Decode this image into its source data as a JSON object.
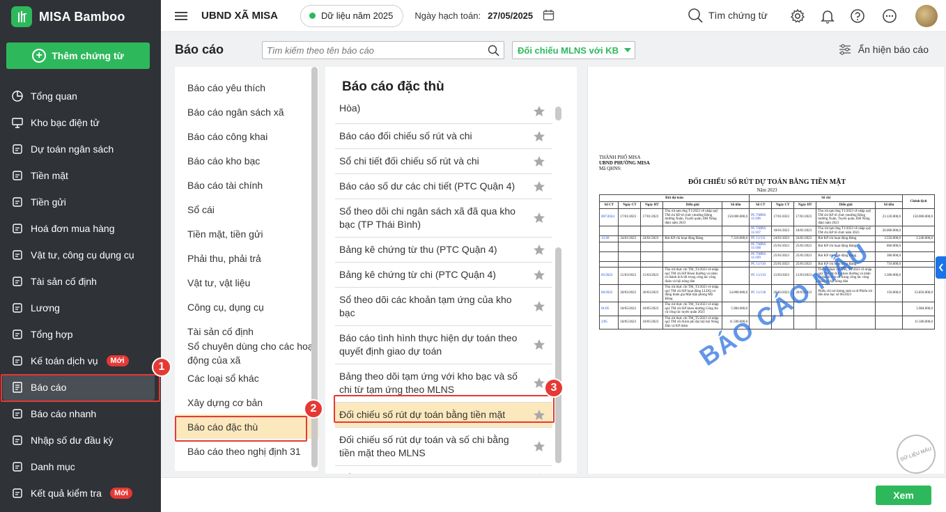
{
  "brand": {
    "name": "MISA Bamboo"
  },
  "sidebar": {
    "add_button": "Thêm chứng từ",
    "new_badge": "Mới",
    "items": [
      {
        "label": "Tổng quan",
        "icon": "pie-chart-icon"
      },
      {
        "label": "Kho bạc điện tử",
        "icon": "monitor-icon"
      },
      {
        "label": "Dự toán ngân sách",
        "icon": "budget-icon"
      },
      {
        "label": "Tiền mặt",
        "icon": "cash-icon"
      },
      {
        "label": "Tiền gửi",
        "icon": "deposit-icon"
      },
      {
        "label": "Hoá đơn mua hàng",
        "icon": "invoice-icon"
      },
      {
        "label": "Vật tư, công cụ dụng cụ",
        "icon": "tools-icon"
      },
      {
        "label": "Tài sản cố định",
        "icon": "building-icon"
      },
      {
        "label": "Lương",
        "icon": "salary-icon"
      },
      {
        "label": "Tổng hợp",
        "icon": "summary-icon"
      },
      {
        "label": "Kế toán dịch vụ",
        "icon": "service-icon",
        "badge": "Mới"
      },
      {
        "label": "Báo cáo",
        "icon": "report-icon",
        "active": true
      },
      {
        "label": "Báo cáo nhanh",
        "icon": "quick-report-icon"
      },
      {
        "label": "Nhập số dư đầu kỳ",
        "icon": "opening-balance-icon"
      },
      {
        "label": "Danh mục",
        "icon": "catalog-icon"
      },
      {
        "label": "Kết quả kiểm tra",
        "icon": "check-result-icon",
        "badge": "Mới"
      }
    ]
  },
  "header": {
    "org": "UBND XÃ MISA",
    "data_year": "Dữ liệu năm 2025",
    "posting_date_label": "Ngày hạch toán:",
    "posting_date": "27/05/2025",
    "search_label": "Tìm chứng từ"
  },
  "toolbar": {
    "title": "Báo cáo",
    "search_placeholder": "Tìm kiếm theo tên báo cáo",
    "filter_value": "Đối chiếu MLNS với KB",
    "toggle_label": "Ẩn hiện báo cáo"
  },
  "categories": [
    "Báo cáo yêu thích",
    "Báo cáo ngân sách xã",
    "Báo cáo công khai",
    "Báo cáo kho bạc",
    "Báo cáo tài chính",
    "Sổ cái",
    "Tiền mặt, tiền gửi",
    "Phải thu, phải trả",
    "Vật tư, vật liệu",
    "Công cụ, dụng cụ",
    "Tài sản cố định",
    "Sổ chuyên dùng cho các hoạt động của xã",
    "Các loại sổ khác",
    "Xây dựng cơ bản",
    "Báo cáo đặc thù",
    "Báo cáo theo nghị định 31"
  ],
  "report_list": {
    "title": "Báo cáo đặc thù",
    "items": [
      "Hòa)",
      "Báo cáo đối chiếu số rút và chi",
      "Sổ chi tiết đối chiếu số rút và chi",
      "Báo cáo số dư các chi tiết (PTC Quận 4)",
      "Sổ theo dõi chi ngân sách xã đã qua kho bạc (TP Thái Bình)",
      "Bảng kê chứng từ thu (PTC Quận 4)",
      "Bảng kê chứng từ chi (PTC Quận 4)",
      "Sổ theo dõi các khoản tạm ứng của kho bạc",
      "Báo cáo tình hình thực hiện dự toán theo quyết định giao dự toán",
      "Bảng theo dõi tạm ứng với kho bạc và số chi từ tạm ứng theo MLNS",
      "Đối chiếu số rút dự toán bằng tiền mặt",
      "Đối chiếu số rút dự toán và số chi bằng tiền mặt theo MLNS",
      "Sổ theo dõi các khoản rút dự toán"
    ]
  },
  "steps": [
    "1",
    "2",
    "3"
  ],
  "preview": {
    "header_lines": [
      "THÀNH PHỐ MISA",
      "UBND PHƯỜNG MISA",
      "Mã QHNS:"
    ],
    "title": "ĐỐI CHIẾU SỐ RÚT DỰ TOÁN BẰNG TIỀN MẶT",
    "year": "Năm 2023",
    "group_withdraw": "Rút dự toán",
    "group_spend": "Số chi",
    "diff_header": "Chênh lệch",
    "columns_withdraw": [
      "Số CT",
      "Ngày CT",
      "Ngày HT",
      "Diễn giải",
      "Số tiền"
    ],
    "columns_spend": [
      "Số CT",
      "Ngày CT",
      "Ngày HT",
      "Diễn giải",
      "Số tiền"
    ],
    "rows": [
      [
        "007/2024",
        "17/01/2023",
        "17/01/2023",
        "Thu rút tạm ứng T1/2023 về nhập quỹ TM chi KP tổ chức (mường Đông mường Xuân, Tuyên quân, ĐH Nông dân) năm 2023",
        "150.000.000,0",
        "PC TMNS 11/106",
        "17/01/2023",
        "17/01/2023",
        "Thu rút tạm ứng T1/2023 về nhập quỹ TM chi KP tổ chức (mường Đông mường Xuân, Tuyên quân, ĐH Nông dân) năm 2023",
        "23.120.000,0",
        "150.000.000,0"
      ],
      [
        "",
        "",
        "",
        "",
        "",
        "PC TMNS 11/107",
        "18/01/2023",
        "18/01/2023",
        "Thu rút tạm ứng T1/2023 về nhập quỹ TM chi KP tổ chức năm 2023",
        "26.000.000,0",
        ""
      ],
      [
        "12/49",
        "24/01/2023",
        "24/01/2023",
        "Rút KP chi hoạt động Đảng",
        "7.310.000,0",
        "PC 11/111",
        "24/01/2023",
        "24/01/2023",
        "Rút KP chi hoạt động Đảng",
        "3.550.000,0",
        "2.240.000,0"
      ],
      [
        "",
        "",
        "",
        "",
        "",
        "PC TMNS 11/108",
        "25/01/2023",
        "25/01/2023",
        "Rút KP chi hoạt động Đảng",
        "860.000,0",
        ""
      ],
      [
        "",
        "",
        "",
        "",
        "",
        "PC TMNS 11/109",
        "25/01/2023",
        "25/01/2023",
        "Rút KP chi hoạt động Đảng",
        "380.000,0",
        ""
      ],
      [
        "",
        "",
        "",
        "",
        "",
        "PC 11/110",
        "25/01/2023",
        "25/01/2023",
        "Rút KP chi hoạt động Đảng",
        "710.000,0",
        ""
      ],
      [
        "05/2023",
        "15/03/2023",
        "15/03/2023",
        "Thu rút thực chi TM_T3/2023 về nhập quỹ TM chi KP Khen thưởng và nhân có thành tích tốt trong công tác công đoàn và hội nông dân",
        "",
        "PC 11/133",
        "15/03/2023",
        "15/03/2023",
        "Thu rút thực chi TM_T3/2023 về nhập quỹ TM chi KP Khen thưởng và nhân có thành tích tốt trong công tác công đoàn và hội nông dân",
        "3.300.000,0",
        ""
      ],
      [
        "06/2023",
        "20/03/2023",
        "20/03/2023",
        "Thu rút thực chi TM_T3/2023 về nhập quỹ TM chi KP hoạt động LLDQ cơ động tham gia Mặt trận phòng Mã Đông",
        "54.000.000,0",
        "PC 11/136",
        "20/03/2023",
        "20/03/2023",
        "Phiếu chi trả lương sinh ra từ Phiếu rút tiền kho bạc số 06/2023",
        "150.000,0",
        "53.850.000,0"
      ],
      [
        "01/05",
        "18/05/2023",
        "18/05/2023",
        "Thu rút thực chi TM_T4/2023 về nhập quỹ TM chi KP khen thưởng Công An và công tác tuyên quân 2023",
        "5.984.000,0",
        "",
        "",
        "",
        "",
        "",
        "5.984.000,0"
      ],
      [
        "2/05",
        "18/05/2023",
        "18/05/2023",
        "Thu rút thực chi TM_T5/2023 về nhập quỹ TM chi Kinh phí đại hội hội Nông Dân và KP thăm",
        "11.500.000,0",
        "",
        "",
        "",
        "",
        "",
        "11.500.000,0"
      ]
    ],
    "watermark": "BÁO CÁO MẪU",
    "stamp": "DỮ LIỆU MẪU"
  },
  "footer": {
    "view_button": "Xem"
  },
  "colors": {
    "sidebar_bg": "#2f3237",
    "accent_green": "#2eb85c",
    "highlight": "#fbe8bd",
    "callout_red": "#e53935"
  }
}
